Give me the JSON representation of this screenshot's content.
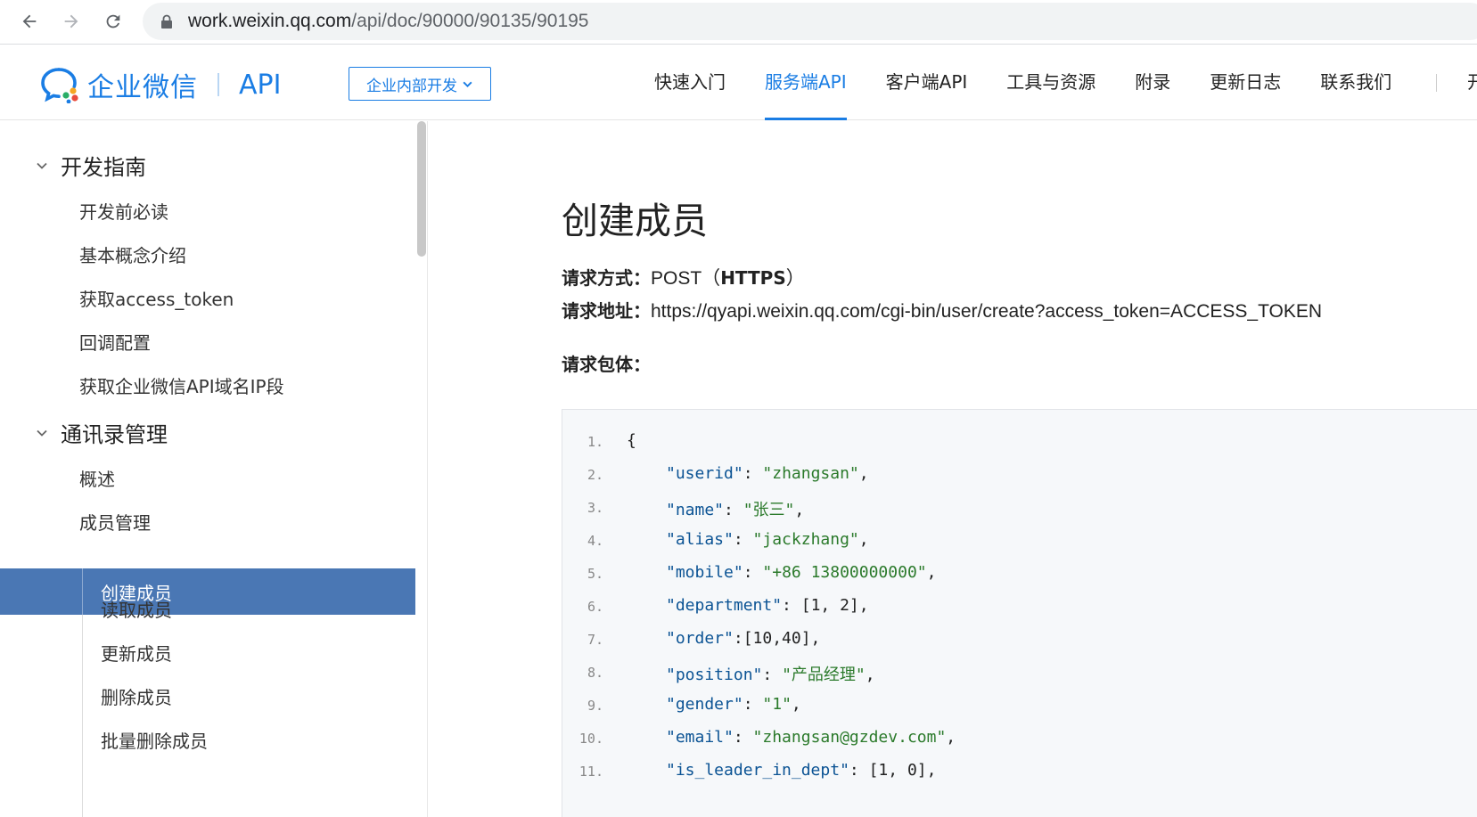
{
  "browser": {
    "url_host": "work.weixin.qq.com",
    "url_path": "/api/doc/90000/90135/90195"
  },
  "header": {
    "logo_text": "企业微信",
    "logo_api": "API",
    "doc_select": "企业内部开发",
    "nav": [
      "快速入门",
      "服务端API",
      "客户端API",
      "工具与资源",
      "附录",
      "更新日志",
      "联系我们"
    ],
    "nav_active_index": 1,
    "nav_cut": "开"
  },
  "sidebar": {
    "groups": [
      {
        "label": "开发指南",
        "items": [
          "开发前必读",
          "基本概念介绍",
          "获取access_token",
          "回调配置",
          "获取企业微信API域名IP段"
        ]
      },
      {
        "label": "通讯录管理",
        "items": [
          "概述",
          "成员管理"
        ]
      }
    ],
    "sub_items": [
      "创建成员",
      "读取成员",
      "更新成员",
      "删除成员",
      "批量删除成员"
    ],
    "active_sub": "创建成员"
  },
  "main": {
    "title": "创建成员",
    "method_label": "请求方式：",
    "method_value": "POST（",
    "method_https": "HTTPS",
    "method_close": "）",
    "address_label": "请求地址：",
    "address_value": "https://qyapi.weixin.qq.com/cgi-bin/user/create?access_token=ACCESS_TOKEN",
    "body_label": "请求包体：",
    "code_lines": [
      {
        "num": "1.",
        "key": "",
        "rest": "{"
      },
      {
        "num": "2.",
        "key": "\"userid\"",
        "sep": ": ",
        "str": "\"zhangsan\"",
        "tail": ","
      },
      {
        "num": "3.",
        "key": "\"name\"",
        "sep": ": ",
        "str": "\"张三\"",
        "tail": ","
      },
      {
        "num": "4.",
        "key": "\"alias\"",
        "sep": ": ",
        "str": "\"jackzhang\"",
        "tail": ","
      },
      {
        "num": "5.",
        "key": "\"mobile\"",
        "sep": ": ",
        "str": "\"+86 13800000000\"",
        "tail": ","
      },
      {
        "num": "6.",
        "key": "\"department\"",
        "sep": ": ",
        "str": "",
        "tail": "[1, 2],"
      },
      {
        "num": "7.",
        "key": "\"order\"",
        "sep": ":",
        "str": "",
        "tail": "[10,40],"
      },
      {
        "num": "8.",
        "key": "\"position\"",
        "sep": ": ",
        "str": "\"产品经理\"",
        "tail": ","
      },
      {
        "num": "9.",
        "key": "\"gender\"",
        "sep": ": ",
        "str": "\"1\"",
        "tail": ","
      },
      {
        "num": "10.",
        "key": "\"email\"",
        "sep": ": ",
        "str": "\"zhangsan@gzdev.com\"",
        "tail": ","
      },
      {
        "num": "11.",
        "key": "\"is_leader_in_dept\"",
        "sep": ": ",
        "str": "",
        "tail": "[1, 0],"
      }
    ]
  },
  "colors": {
    "brand": "#1a7de4",
    "active_bg": "#4a77b4",
    "code_bg": "#f6f8fa",
    "code_key": "#0b5394",
    "code_string": "#2b7a2b"
  },
  "icons": [
    "back-arrow-icon",
    "forward-arrow-icon",
    "reload-icon",
    "lock-icon",
    "wecom-logo-icon",
    "chevron-down-icon"
  ]
}
